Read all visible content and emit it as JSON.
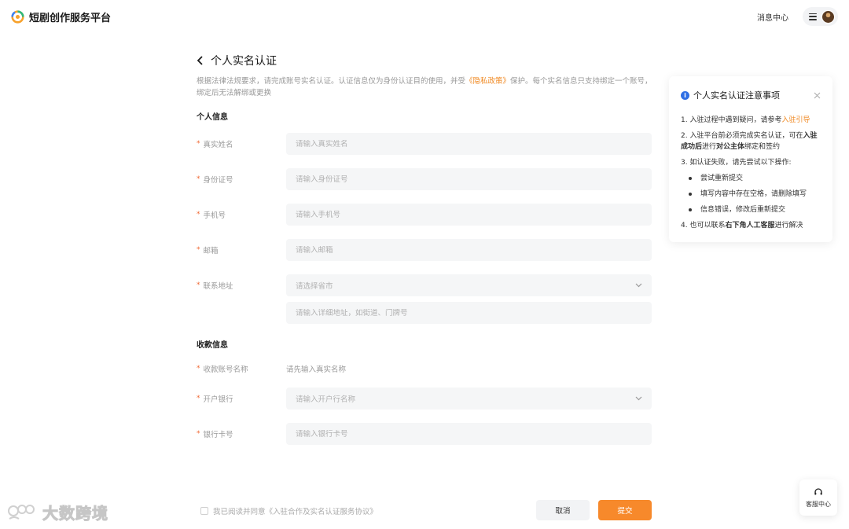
{
  "header": {
    "brand_name": "短剧创作服务平台",
    "message_center": "消息中心"
  },
  "page": {
    "title": "个人实名认证",
    "notice_part1": "根据法律法规要求，请完成账号实名认证。认证信息仅为身份认证目的使用，并受",
    "notice_link": "《隐私政策》",
    "notice_part2": "保护。每个实名信息只支持绑定一个账号，绑定后无法解绑或更换"
  },
  "personal_section": {
    "title": "个人信息",
    "fields": [
      {
        "label": "真实姓名",
        "placeholder": "请输入真实姓名"
      },
      {
        "label": "身份证号",
        "placeholder": "请输入身份证号"
      },
      {
        "label": "手机号",
        "placeholder": "请输入手机号"
      },
      {
        "label": "邮箱",
        "placeholder": "请输入邮箱"
      }
    ],
    "address": {
      "label": "联系地址",
      "select_placeholder": "请选择省市",
      "detail_placeholder": "请输入详细地址，如街道、门牌号"
    }
  },
  "payment_section": {
    "title": "收款信息",
    "account_name": {
      "label": "收款账号名称",
      "value": "请先输入真实名称"
    },
    "bank": {
      "label": "开户银行",
      "placeholder": "请输入开户行名称"
    },
    "card": {
      "label": "银行卡号",
      "placeholder": "请输入银行卡号"
    }
  },
  "footer": {
    "agree_text": "我已阅读并同意《入驻合作及实名认证服务协议》",
    "cancel": "取消",
    "submit": "提交"
  },
  "tips": {
    "title": "个人实名认证注意事项",
    "item1_a": "1. 入驻过程中遇到疑问，请参考",
    "item1_link": "入驻引导",
    "item2_a": "2. 入驻平台前必须完成实名认证，可在",
    "item2_b": "入驻成功后",
    "item2_c": "进行",
    "item2_d": "对公主体",
    "item2_e": "绑定和签约",
    "item3": "3. 如认证失败，请先尝试以下操作:",
    "sub_items": [
      "尝试重新提交",
      "填写内容中存在空格，请删除填写",
      "信息错误，修改后重新提交"
    ],
    "item4_a": "4. 也可以联系",
    "item4_b": "右下角人工客服",
    "item4_c": "进行解决"
  },
  "customer_service": {
    "label": "客服中心"
  },
  "watermark": {
    "text": "大数跨境"
  },
  "colors": {
    "accent": "#f7892b",
    "info": "#2f6fe4",
    "required": "#f0652f"
  }
}
